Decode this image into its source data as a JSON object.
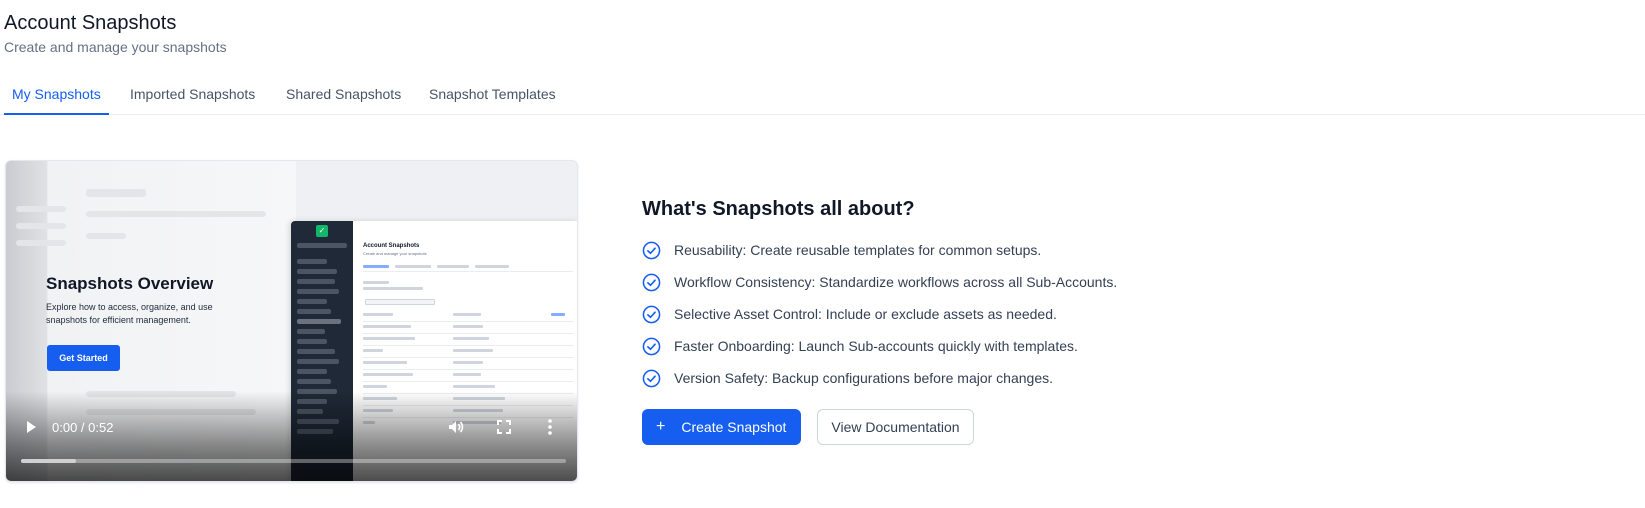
{
  "header": {
    "title": "Account Snapshots",
    "subtitle": "Create and manage your snapshots"
  },
  "tabs": [
    {
      "label": "My Snapshots",
      "active": true
    },
    {
      "label": "Imported Snapshots",
      "active": false
    },
    {
      "label": "Shared Snapshots",
      "active": false
    },
    {
      "label": "Snapshot Templates",
      "active": false
    }
  ],
  "video": {
    "overlay_title": "Snapshots Overview",
    "overlay_description": "Explore how to access, organize, and use snapshots for efficient management.",
    "cta_label": "Get Started",
    "mock_app_title": "Account Snapshots",
    "mock_app_subtitle": "Create and manage your snapshots",
    "time": "0:00 / 0:52",
    "progress": 0.1,
    "icons": {
      "play": "play-icon",
      "volume": "volume-icon",
      "fullscreen": "fullscreen-icon",
      "more": "more-vertical-icon"
    }
  },
  "info": {
    "title": "What's Snapshots all about?",
    "features": [
      "Reusability: Create reusable templates for common setups.",
      "Workflow Consistency: Standardize workflows across all Sub-Accounts.",
      "Selective Asset Control: Include or exclude assets as needed.",
      "Faster Onboarding: Launch Sub-accounts quickly with templates.",
      "Version Safety: Backup configurations before major changes."
    ],
    "feature_icon": "check-circle-icon"
  },
  "actions": {
    "create_label": "Create Snapshot",
    "create_icon": "plus-icon",
    "docs_label": "View Documentation"
  },
  "colors": {
    "accent": "#155eef",
    "text_primary": "#101828",
    "text_secondary": "#667085"
  }
}
